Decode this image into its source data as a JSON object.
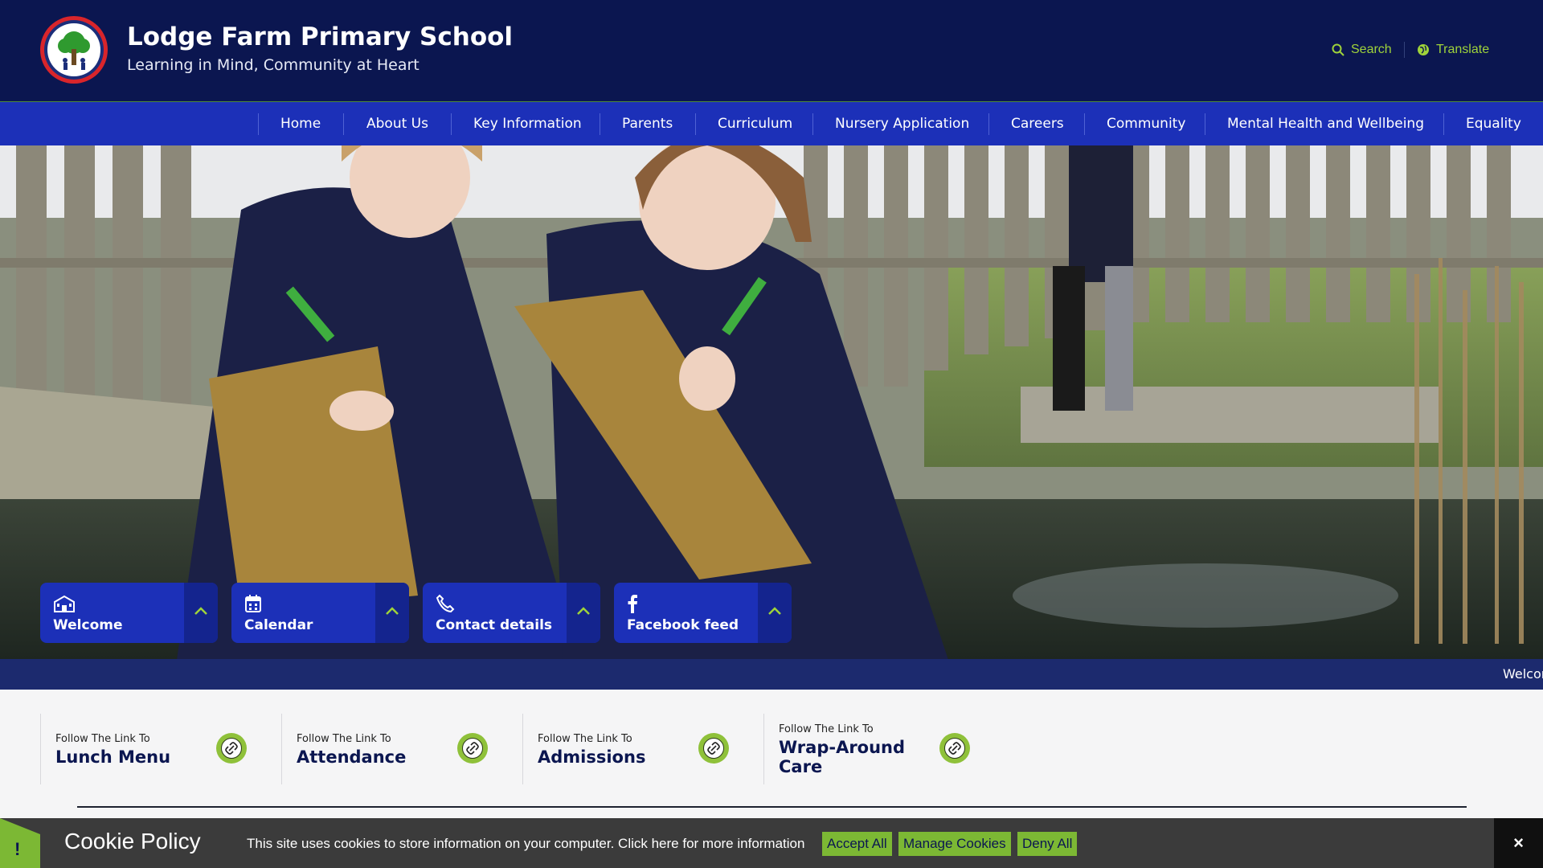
{
  "header": {
    "school_name": "Lodge Farm Primary School",
    "tagline": "Learning in Mind, Community at Heart",
    "search_label": "Search",
    "translate_label": "Translate"
  },
  "nav": {
    "items": [
      {
        "label": "Home"
      },
      {
        "label": "About Us"
      },
      {
        "label": "Key Information"
      },
      {
        "label": "Parents"
      },
      {
        "label": "Curriculum"
      },
      {
        "label": "Nursery Application"
      },
      {
        "label": "Careers"
      },
      {
        "label": "Community"
      },
      {
        "label": "Mental Health and Wellbeing"
      },
      {
        "label": "Equality"
      }
    ]
  },
  "quick_tabs": [
    {
      "label": "Welcome",
      "icon": "school-icon"
    },
    {
      "label": "Calendar",
      "icon": "calendar-icon"
    },
    {
      "label": "Contact details",
      "icon": "phone-icon"
    },
    {
      "label": "Facebook feed",
      "icon": "facebook-icon"
    }
  ],
  "ticker": {
    "text": "Welcor"
  },
  "quick_links": [
    {
      "prefix": "Follow The Link To",
      "title": "Lunch Menu"
    },
    {
      "prefix": "Follow The Link To",
      "title": "Attendance"
    },
    {
      "prefix": "Follow The Link To",
      "title": "Admissions"
    },
    {
      "prefix": "Follow The Link To",
      "title": "Wrap-Around Care"
    }
  ],
  "cookie": {
    "flag_symbol": "!",
    "title": "Cookie Policy",
    "message": "This site uses cookies to store information on your computer. Click here for more information",
    "accept_label": "Accept All",
    "manage_label": "Manage Cookies",
    "deny_label": "Deny All",
    "close_symbol": "×"
  },
  "colors": {
    "header_bg": "#0b1650",
    "nav_bg": "#1c30b8",
    "accent_green": "#7cb834",
    "ticker_bg": "#1c2a6e"
  }
}
